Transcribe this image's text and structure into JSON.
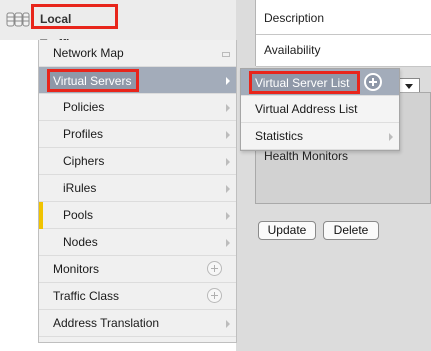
{
  "properties": {
    "description_label": "Description",
    "availability_label": "Availability",
    "health_monitors_label": "Health Monitors"
  },
  "buttons": {
    "update": "Update",
    "delete": "Delete"
  },
  "nav": {
    "section_title": "Local Traffic",
    "section_icon": "database-stack-icon",
    "items": [
      {
        "label": "Network Map",
        "icon": "map-icon"
      },
      {
        "label": "Virtual Servers",
        "selected": true
      },
      {
        "label": "Policies"
      },
      {
        "label": "Profiles"
      },
      {
        "label": "Ciphers"
      },
      {
        "label": "iRules"
      },
      {
        "label": "Pools",
        "marker_color": "#f0c300"
      },
      {
        "label": "Nodes"
      },
      {
        "label": "Monitors",
        "icon": "plus-circle-icon"
      },
      {
        "label": "Traffic Class",
        "icon": "plus-circle-icon"
      },
      {
        "label": "Address Translation"
      }
    ]
  },
  "submenu": {
    "items": [
      {
        "label": "Virtual Server List",
        "selected": true,
        "icon": "plus-circle-icon"
      },
      {
        "label": "Virtual Address List"
      },
      {
        "label": "Statistics"
      }
    ]
  },
  "colors": {
    "highlight": "#e8251b",
    "selected_bg": "#a3acba",
    "pools_marker": "#f0c300"
  }
}
